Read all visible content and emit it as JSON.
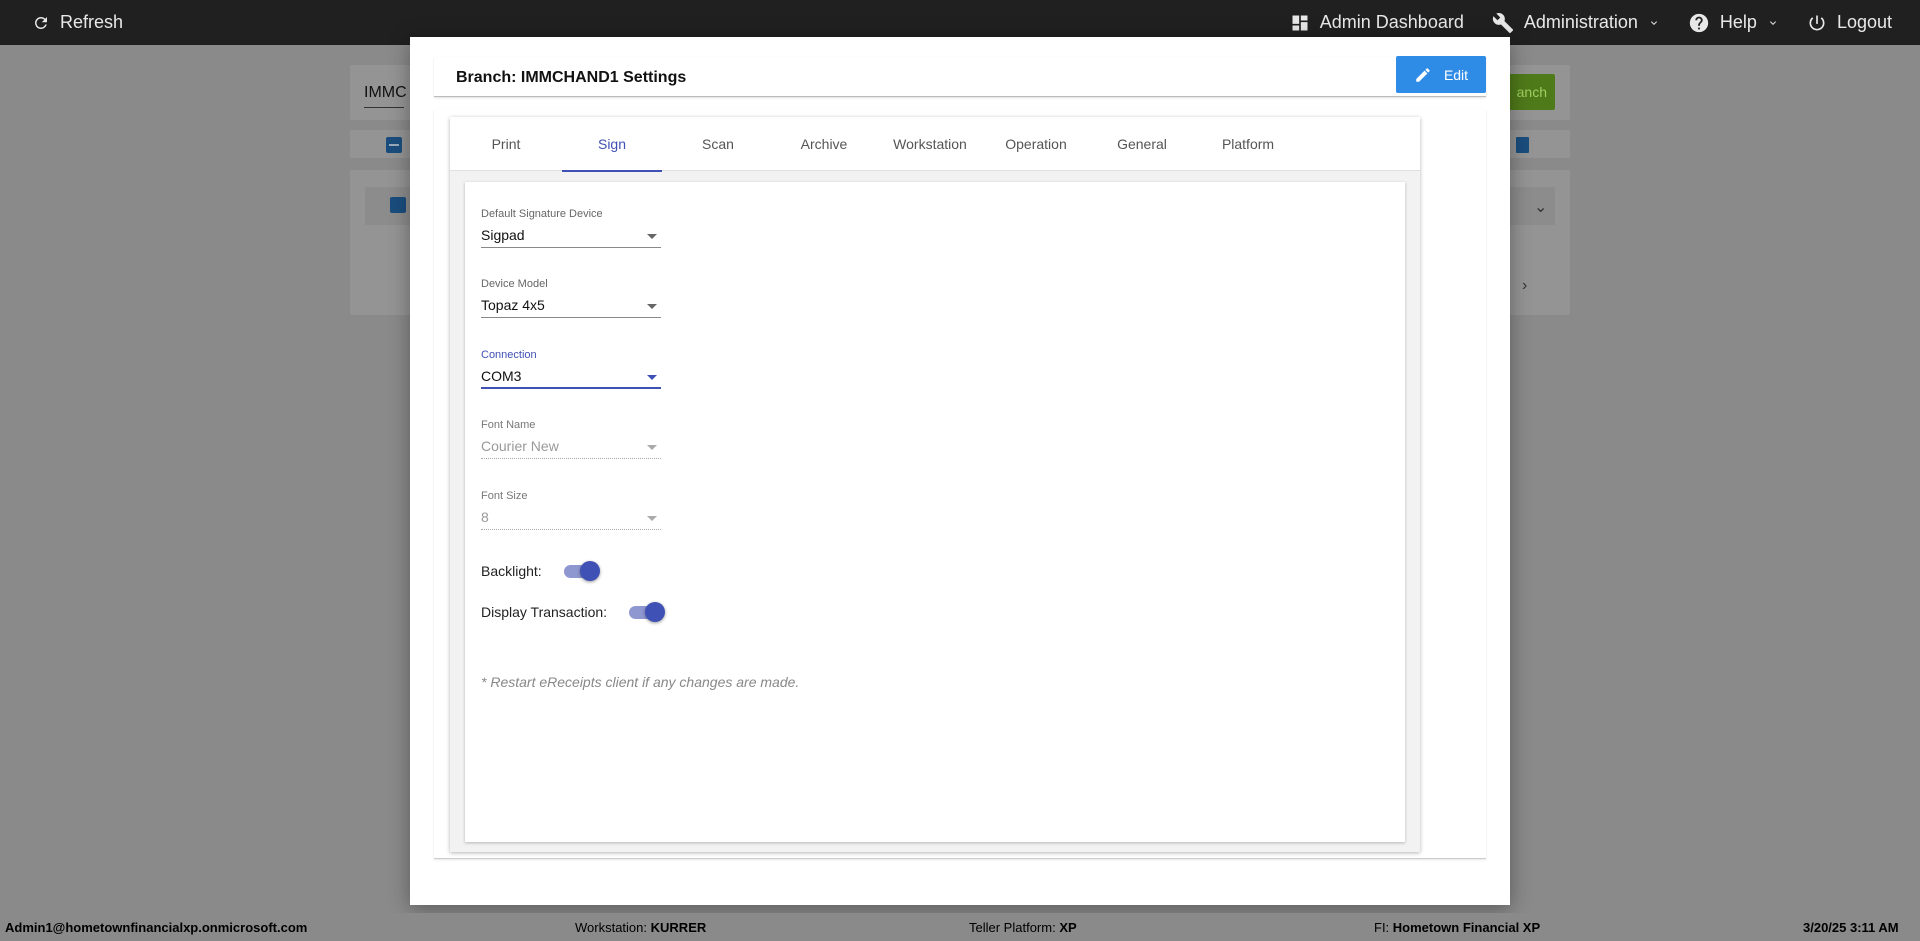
{
  "topbar": {
    "refresh_label": "Refresh",
    "admin_dashboard_label": "Admin Dashboard",
    "administration_label": "Administration",
    "help_label": "Help",
    "logout_label": "Logout"
  },
  "background": {
    "search_value": "IMMC",
    "add_branch_label": "anch"
  },
  "modal": {
    "title": "Branch: IMMCHAND1 Settings",
    "edit_label": "Edit",
    "tabs": [
      {
        "label": "Print"
      },
      {
        "label": "Sign",
        "active": true
      },
      {
        "label": "Scan"
      },
      {
        "label": "Archive"
      },
      {
        "label": "Workstation"
      },
      {
        "label": "Operation"
      },
      {
        "label": "General"
      },
      {
        "label": "Platform"
      }
    ],
    "fields": {
      "default_signature_device": {
        "label": "Default Signature Device",
        "value": "Sigpad"
      },
      "device_model": {
        "label": "Device Model",
        "value": "Topaz 4x5"
      },
      "connection": {
        "label": "Connection",
        "value": "COM3"
      },
      "font_name": {
        "label": "Font Name",
        "value": "Courier New"
      },
      "font_size": {
        "label": "Font Size",
        "value": "8"
      }
    },
    "toggles": {
      "backlight": {
        "label": "Backlight:",
        "on": true
      },
      "display_transaction": {
        "label": "Display Transaction:",
        "on": true
      }
    },
    "note": "* Restart eReceipts client if any changes are made."
  },
  "footer": {
    "user": "Admin1@hometownfinancialxp.onmicrosoft.com",
    "workstation_label": "Workstation:",
    "workstation_value": "KURRER",
    "teller_platform_label": "Teller Platform:",
    "teller_platform_value": "XP",
    "fi_label": "FI:",
    "fi_value": "Hometown Financial XP",
    "datetime": "3/20/25 3:11 AM"
  },
  "colors": {
    "accent": "#3f51b5",
    "edit_button": "#2e8be6",
    "topbar": "#202020",
    "overlay": "#8a8a8a"
  }
}
